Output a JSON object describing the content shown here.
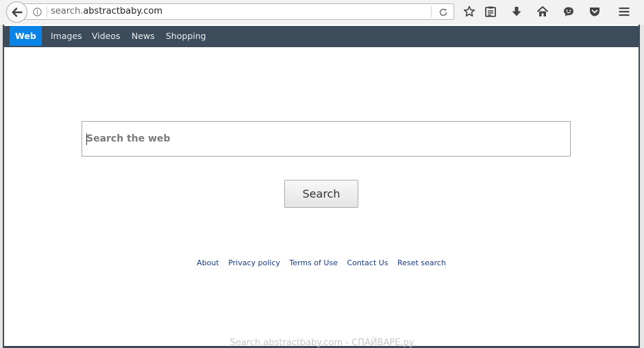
{
  "browser": {
    "url_prefix": "search.",
    "url_domain": "abstractbaby.com"
  },
  "nav": {
    "items": [
      {
        "label": "Web",
        "active": true
      },
      {
        "label": "Images",
        "active": false
      },
      {
        "label": "Videos",
        "active": false
      },
      {
        "label": "News",
        "active": false
      },
      {
        "label": "Shopping",
        "active": false
      }
    ]
  },
  "search": {
    "placeholder": "Search the web",
    "button_label": "Search"
  },
  "footer": {
    "links": [
      "About",
      "Privacy policy",
      "Terms of Use",
      "Contact Us",
      "Reset search"
    ]
  },
  "watermark": "Search.abstractbaby.com - СПАЙВАРЕ.ру",
  "colors": {
    "navbar_bg": "#3d4c5b",
    "nav_active": "#0a83e6",
    "footer_link": "#1b3a7a"
  }
}
